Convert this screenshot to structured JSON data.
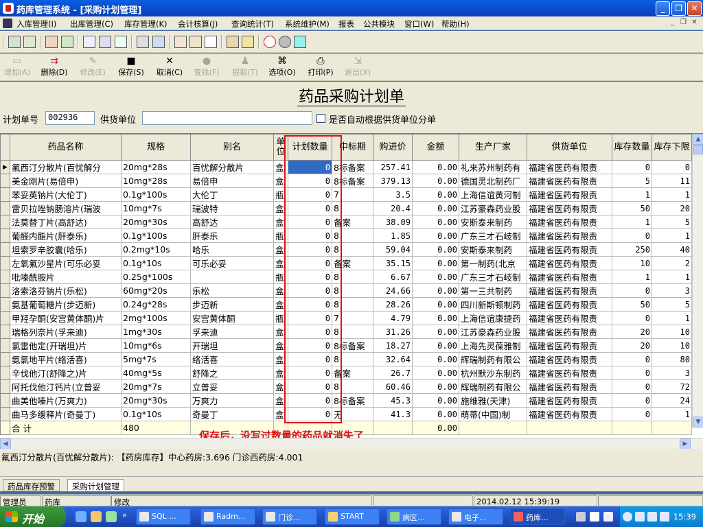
{
  "window": {
    "title": "药库管理系统 - [采购计划管理]"
  },
  "menu": [
    "入库管理(I)",
    "出库管理(C)",
    "库存管理(K)",
    "会计核算(J)",
    "查询统计(T)",
    "系统维护(M)",
    "报表",
    "公共模块",
    "窗口(W)",
    "帮助(H)"
  ],
  "toolbar": {
    "add": "增加(A)",
    "delete": "删除(D)",
    "modify": "修改(E)",
    "save": "保存(S)",
    "cancel": "取消(C)",
    "find": "查找(F)",
    "extract": "提取(T)",
    "options": "选项(O)",
    "print": "打印(P)",
    "exit": "退出(X)"
  },
  "form": {
    "title": "药品采购计划单",
    "plan_no_label": "计划单号",
    "plan_no": "002936",
    "supplier_label": "供货单位",
    "supplier_value": "",
    "auto_split_label": "是否自动根据供货单位分单"
  },
  "grid": {
    "columns": [
      "药品名称",
      "规格",
      "别名",
      "单位",
      "计划数量",
      "中标期",
      "购进价",
      "金额",
      "生产厂家",
      "供货单位",
      "库存数量",
      "库存下限"
    ],
    "rows": [
      [
        "氟西汀分散片(百忧解分",
        "20mg*28s",
        "百忧解分散片",
        "盒",
        "0",
        "8标备案",
        "257.41",
        "0.00",
        "礼来苏州制药有",
        "福建省医药有限责",
        "0",
        "0"
      ],
      [
        "美金刚片(易倍申)",
        "10mg*28s",
        "易倍申",
        "盒",
        "0",
        "8标备案",
        "379.13",
        "0.00",
        "德国灵北制药厂",
        "福建省医药有限责",
        "5",
        "11"
      ],
      [
        "苯妥英钠片(大伦丁)",
        "0.1g*100s",
        "大伦丁",
        "瓶",
        "0",
        "7",
        "3.5",
        "0.00",
        "上海信谊黄河制",
        "福建省医药有限责",
        "1",
        "1"
      ],
      [
        "雷贝拉唑钠肠溶片(瑞波",
        "10mg*7s",
        "瑞波特",
        "盒",
        "0",
        "8",
        "20.4",
        "0.00",
        "江苏豪森药业股",
        "福建省医药有限责",
        "50",
        "20"
      ],
      [
        "法莫替丁片(高舒达)",
        "20mg*30s",
        "高舒达",
        "盒",
        "0",
        "备案",
        "38.09",
        "0.00",
        "安斯泰来制药",
        "福建省医药有限责",
        "1",
        "5"
      ],
      [
        "葡醛内酯片(肝泰乐)",
        "0.1g*100s",
        "肝泰乐",
        "瓶",
        "0",
        "8",
        "1.85",
        "0.00",
        "广东三才石岐制",
        "福建省医药有限责",
        "0",
        "1"
      ],
      [
        "坦索罗辛胶囊(哈乐)",
        "0.2mg*10s",
        "哈乐",
        "盒",
        "0",
        "8",
        "59.04",
        "0.00",
        "安斯泰来制药",
        "福建省医药有限责",
        "250",
        "40"
      ],
      [
        "左氧氟沙星片(可乐必妥",
        "0.1g*10s",
        "可乐必妥",
        "盒",
        "0",
        "备案",
        "35.15",
        "0.00",
        "第一制药(北京",
        "福建省医药有限责",
        "10",
        "2"
      ],
      [
        "吡嗪酰胺片",
        "0.25g*100s",
        "",
        "瓶",
        "0",
        "8",
        "6.67",
        "0.00",
        "广东三才石岐制",
        "福建省医药有限责",
        "1",
        "1"
      ],
      [
        "洛索洛芬钠片(乐松)",
        "60mg*20s",
        "乐松",
        "盒",
        "0",
        "8",
        "24.66",
        "0.00",
        "第一三共制药",
        "福建省医药有限责",
        "0",
        "3"
      ],
      [
        "氨基葡萄糖片(步迈新)",
        "0.24g*28s",
        "步迈新",
        "盒",
        "0",
        "8",
        "28.26",
        "0.00",
        "四川新斯顿制药",
        "福建省医药有限责",
        "50",
        "5"
      ],
      [
        "甲羟孕酮(安宫黄体酮)片",
        "2mg*100s",
        "安宫黄体酮",
        "瓶",
        "0",
        "7",
        "4.79",
        "0.00",
        "上海信谊康捷药",
        "福建省医药有限责",
        "0",
        "1"
      ],
      [
        "瑞格列奈片(孚来迪)",
        "1mg*30s",
        "孚来迪",
        "盒",
        "0",
        "8",
        "31.26",
        "0.00",
        "江苏豪森药业股",
        "福建省医药有限责",
        "20",
        "10"
      ],
      [
        "氯雷他定(开瑞坦)片",
        "10mg*6s",
        "开瑞坦",
        "盒",
        "0",
        "8标备案",
        "18.27",
        "0.00",
        "上海先灵葆雅制",
        "福建省医药有限责",
        "20",
        "10"
      ],
      [
        "氨氯地平片(络活喜)",
        "5mg*7s",
        "络活喜",
        "盒",
        "0",
        "8",
        "32.64",
        "0.00",
        "辉瑞制药有限公",
        "福建省医药有限责",
        "0",
        "80"
      ],
      [
        "辛伐他汀(舒降之)片",
        "40mg*5s",
        "舒降之",
        "盒",
        "0",
        "备案",
        "26.7",
        "0.00",
        "杭州默沙东制药",
        "福建省医药有限责",
        "0",
        "3"
      ],
      [
        "阿托伐他汀钙片(立普妥",
        "20mg*7s",
        "立普妥",
        "盒",
        "0",
        "8",
        "60.46",
        "0.00",
        "辉瑞制药有限公",
        "福建省医药有限责",
        "0",
        "72"
      ],
      [
        "曲美他嗪片(万爽力)",
        "20mg*30s",
        "万爽力",
        "盒",
        "0",
        "8标备案",
        "45.3",
        "0.00",
        "施维雅(天津)",
        "福建省医药有限责",
        "0",
        "24"
      ],
      [
        "曲马多缓释片(奇曼丁)",
        "0.1g*10s",
        "奇曼丁",
        "盒",
        "0",
        "无",
        "41.3",
        "0.00",
        "萌蒂(中国)制",
        "福建省医药有限责",
        "0",
        "1"
      ]
    ],
    "total_label": "合 计",
    "total_spec": "480",
    "total_amount": "0.00"
  },
  "annotation": "保存后，没写过数量的药品就消失了",
  "info_line": "氟西汀分散片(百忧解分散片): 【药房库存】中心药房:3.696  门诊西药房:4.001",
  "tabs": [
    "药品库存预警",
    "采购计划管理"
  ],
  "status": {
    "user": "管理员",
    "dept": "药库",
    "mode": "修改",
    "datetime": "2014.02.12 15:39:19"
  },
  "taskbar": {
    "start": "开始",
    "tasks": [
      "SQL ...",
      "Radm...",
      "门诊...",
      "START",
      "病区...",
      "电子...",
      "药库..."
    ],
    "clock": "15:39"
  },
  "colors": {
    "selection": "#316ac5",
    "annotation": "#e01010",
    "chrome": "#ece9d8"
  }
}
